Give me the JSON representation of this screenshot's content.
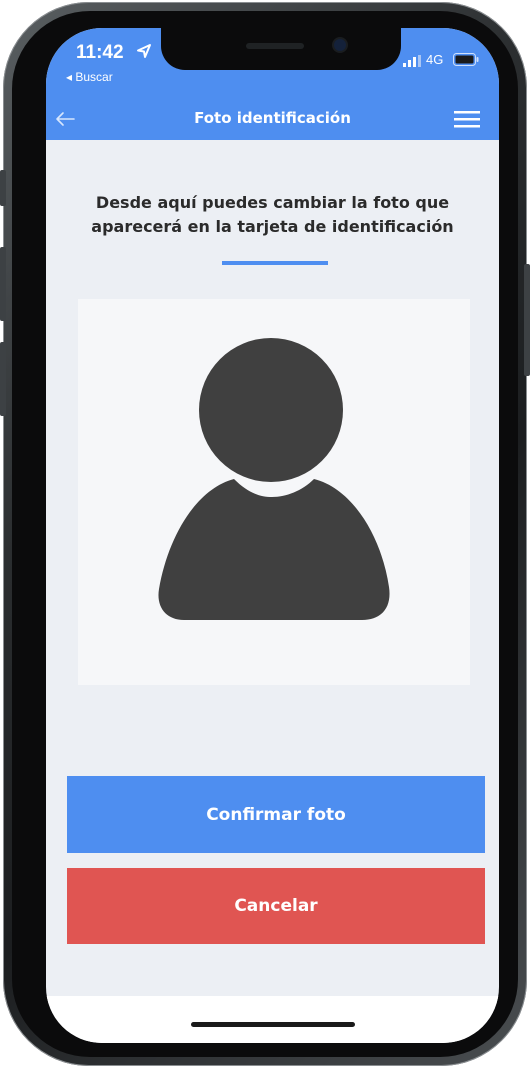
{
  "status_bar": {
    "time": "11:42",
    "back_app": "◂ Buscar",
    "network": "4G",
    "icons": [
      "location-arrow-icon",
      "signal-bars-icon",
      "battery-icon"
    ]
  },
  "navbar": {
    "title": "Foto identificación",
    "back_icon": "arrow-left-icon",
    "menu_icon": "hamburger-menu-icon"
  },
  "main": {
    "headline": "Desde aquí puedes cambiar la foto que aparecerá en la tarjeta de identificación",
    "photo_icon": "user-silhouette-icon"
  },
  "buttons": {
    "confirm_label": "Confirmar foto",
    "cancel_label": "Cancelar"
  },
  "colors": {
    "primary": "#4e8ef0",
    "danger": "#e05552",
    "background": "#eceff4",
    "avatar": "#404040"
  }
}
